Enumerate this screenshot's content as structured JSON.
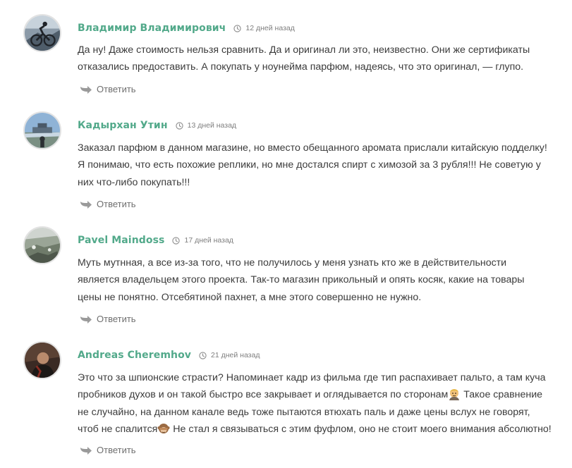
{
  "colors": {
    "author": "#52a98a",
    "text": "#3b3b3b",
    "meta": "#7e7e7e",
    "reply": "#6f6f6f"
  },
  "icons": {
    "time": "clock-icon",
    "reply": "reply-arrow-icon"
  },
  "comments": [
    {
      "author": "Владимир Владимирович",
      "time": "12 дней назад",
      "lines": [
        "Да ну! Даже стоимость нельзя сравнить. Да и оригинал ли это, неизвестно. Они же сертификаты",
        "отказались предоставить. А покупать у ноунейма парфюм, надеясь, что это оригинал, — глупо."
      ],
      "reply": "Ответить"
    },
    {
      "author": "Кадырхан Утин",
      "time": "13 дней назад",
      "lines": [
        "Заказал парфюм в данном магазине, но вместо обещанного аромата прислали китайскую подделку!",
        "Я понимаю, что есть похожие реплики, но мне достался спирт с химозой за 3 рубля!!! Не советую у",
        "них что-либо покупать!!!"
      ],
      "reply": "Ответить"
    },
    {
      "author": "Pavel Maindoss",
      "time": "17 дней назад",
      "lines": [
        "Муть мутнная, а все из-за того, что не получилось у меня узнать кто же в действительности",
        "является владельцем этого проекта. Так-то магазин прикольный и опять косяк, какие на товары",
        "цены не понятно. Отсебятиной пахнет, а мне этого совершенно не нужно."
      ],
      "reply": "Ответить"
    },
    {
      "author": "Andreas Cheremhov",
      "time": "21 дней назад",
      "lines": [
        "Это что за шпионские страсти? Напоминает кадр из фильма где тип распахивает пальто, а там куча",
        "пробников духов и он такой быстро все закрывает и оглядывается по сторонам",
        "Такое сравнение",
        "не случайно, на данном канале ведь тоже пытаются втюхать паль и даже цены вслух не говорят,",
        "чтоб не спалится",
        "Не стал я связываться с этим фуфлом, оно не стоит моего внимания абсолютно!"
      ],
      "emojis": [
        "man-emoji",
        "see-no-evil-monkey-emoji"
      ],
      "reply": "Ответить"
    }
  ]
}
